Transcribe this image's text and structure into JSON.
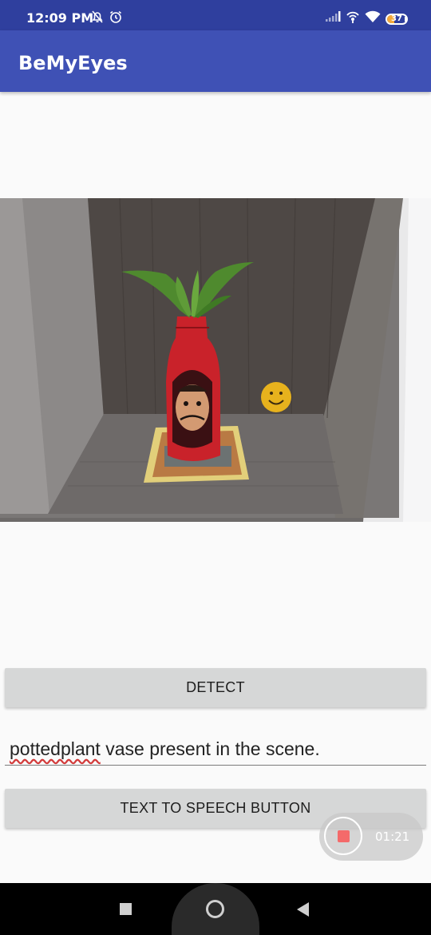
{
  "status_bar": {
    "time": "12:09 PM",
    "battery_level": "37",
    "icons": [
      "bell-off-icon",
      "alarm-icon",
      "signal-icon",
      "hotspot-icon",
      "wifi-icon",
      "battery-icon"
    ]
  },
  "app_bar": {
    "title": "BeMyEyes"
  },
  "main": {
    "photo": {
      "icon": "photo-icon"
    },
    "detect_label": "DETECT",
    "result_text_misspelled": "pottedplant",
    "result_text_rest": " vase present in the scene.",
    "tts_label": "TEXT TO SPEECH BUTTON"
  },
  "recorder": {
    "elapsed": "01:21",
    "icon": "stop-record-icon"
  },
  "nav_bar": {
    "icons": [
      "recent-apps-icon",
      "home-icon",
      "back-icon"
    ]
  },
  "colors": {
    "app_bar": "#3f51b5",
    "status_bar": "#2f3f9e",
    "button": "#d6d7d7",
    "battery": "#f2a93b",
    "recorder_dot": "#f46a6a"
  }
}
